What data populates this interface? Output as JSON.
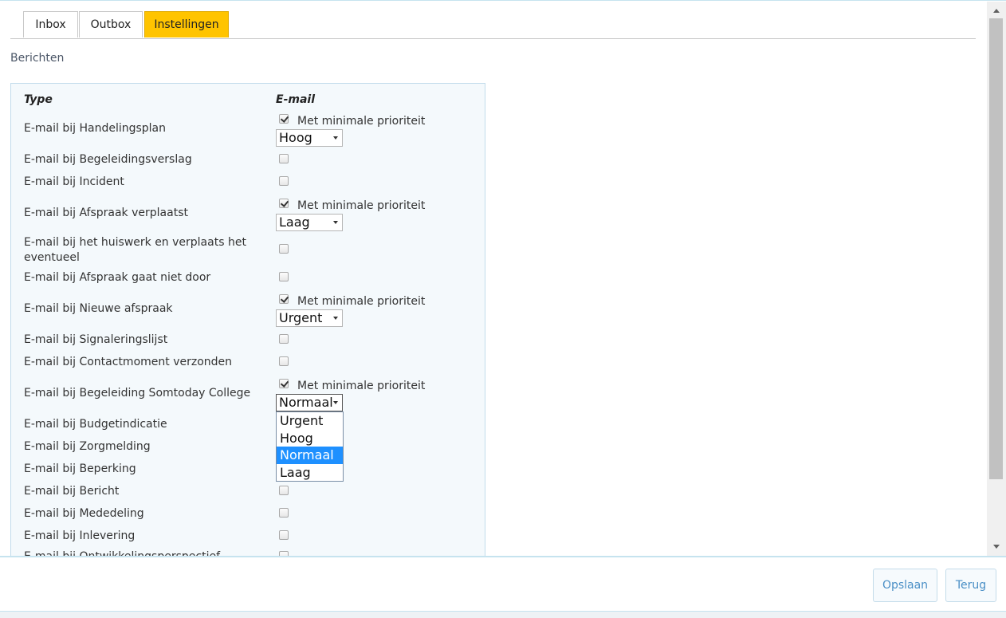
{
  "tabs": [
    {
      "label": "Inbox",
      "active": false
    },
    {
      "label": "Outbox",
      "active": false
    },
    {
      "label": "Instellingen",
      "active": true
    }
  ],
  "section_title": "Berichten",
  "columns": {
    "type": "Type",
    "email": "E-mail"
  },
  "priority_label": "Met minimale prioriteit",
  "priority_options": [
    "Urgent",
    "Hoog",
    "Normaal",
    "Laag"
  ],
  "rows": [
    {
      "label": "E-mail bij Handelingsplan",
      "checked": true,
      "priority": "Hoog"
    },
    {
      "label": "E-mail bij Begeleidingsverslag",
      "checked": false
    },
    {
      "label": "E-mail bij Incident",
      "checked": false
    },
    {
      "label": "E-mail bij Afspraak verplaatst",
      "checked": true,
      "priority": "Laag"
    },
    {
      "label": "E-mail bij het huiswerk en verplaats het eventueel",
      "checked": false
    },
    {
      "label": "E-mail bij Afspraak gaat niet door",
      "checked": false
    },
    {
      "label": "E-mail bij Nieuwe afspraak",
      "checked": true,
      "priority": "Urgent"
    },
    {
      "label": "E-mail bij Signaleringslijst",
      "checked": false
    },
    {
      "label": "E-mail bij Contactmoment verzonden",
      "checked": false
    },
    {
      "label": "E-mail bij Begeleiding Somtoday College",
      "checked": true,
      "priority": "Normaal",
      "dropdown_open": true
    },
    {
      "label": "E-mail bij Budgetindicatie",
      "checked": false
    },
    {
      "label": "E-mail bij Zorgmelding",
      "checked": false
    },
    {
      "label": "E-mail bij Beperking",
      "checked": false
    },
    {
      "label": "E-mail bij Bericht",
      "checked": false
    },
    {
      "label": "E-mail bij Mededeling",
      "checked": false
    },
    {
      "label": "E-mail bij Inlevering",
      "checked": false
    },
    {
      "label": "E-mail bij Ontwikkelingsperspectief",
      "checked": false
    }
  ],
  "buttons": {
    "save": "Opslaan",
    "back": "Terug"
  }
}
